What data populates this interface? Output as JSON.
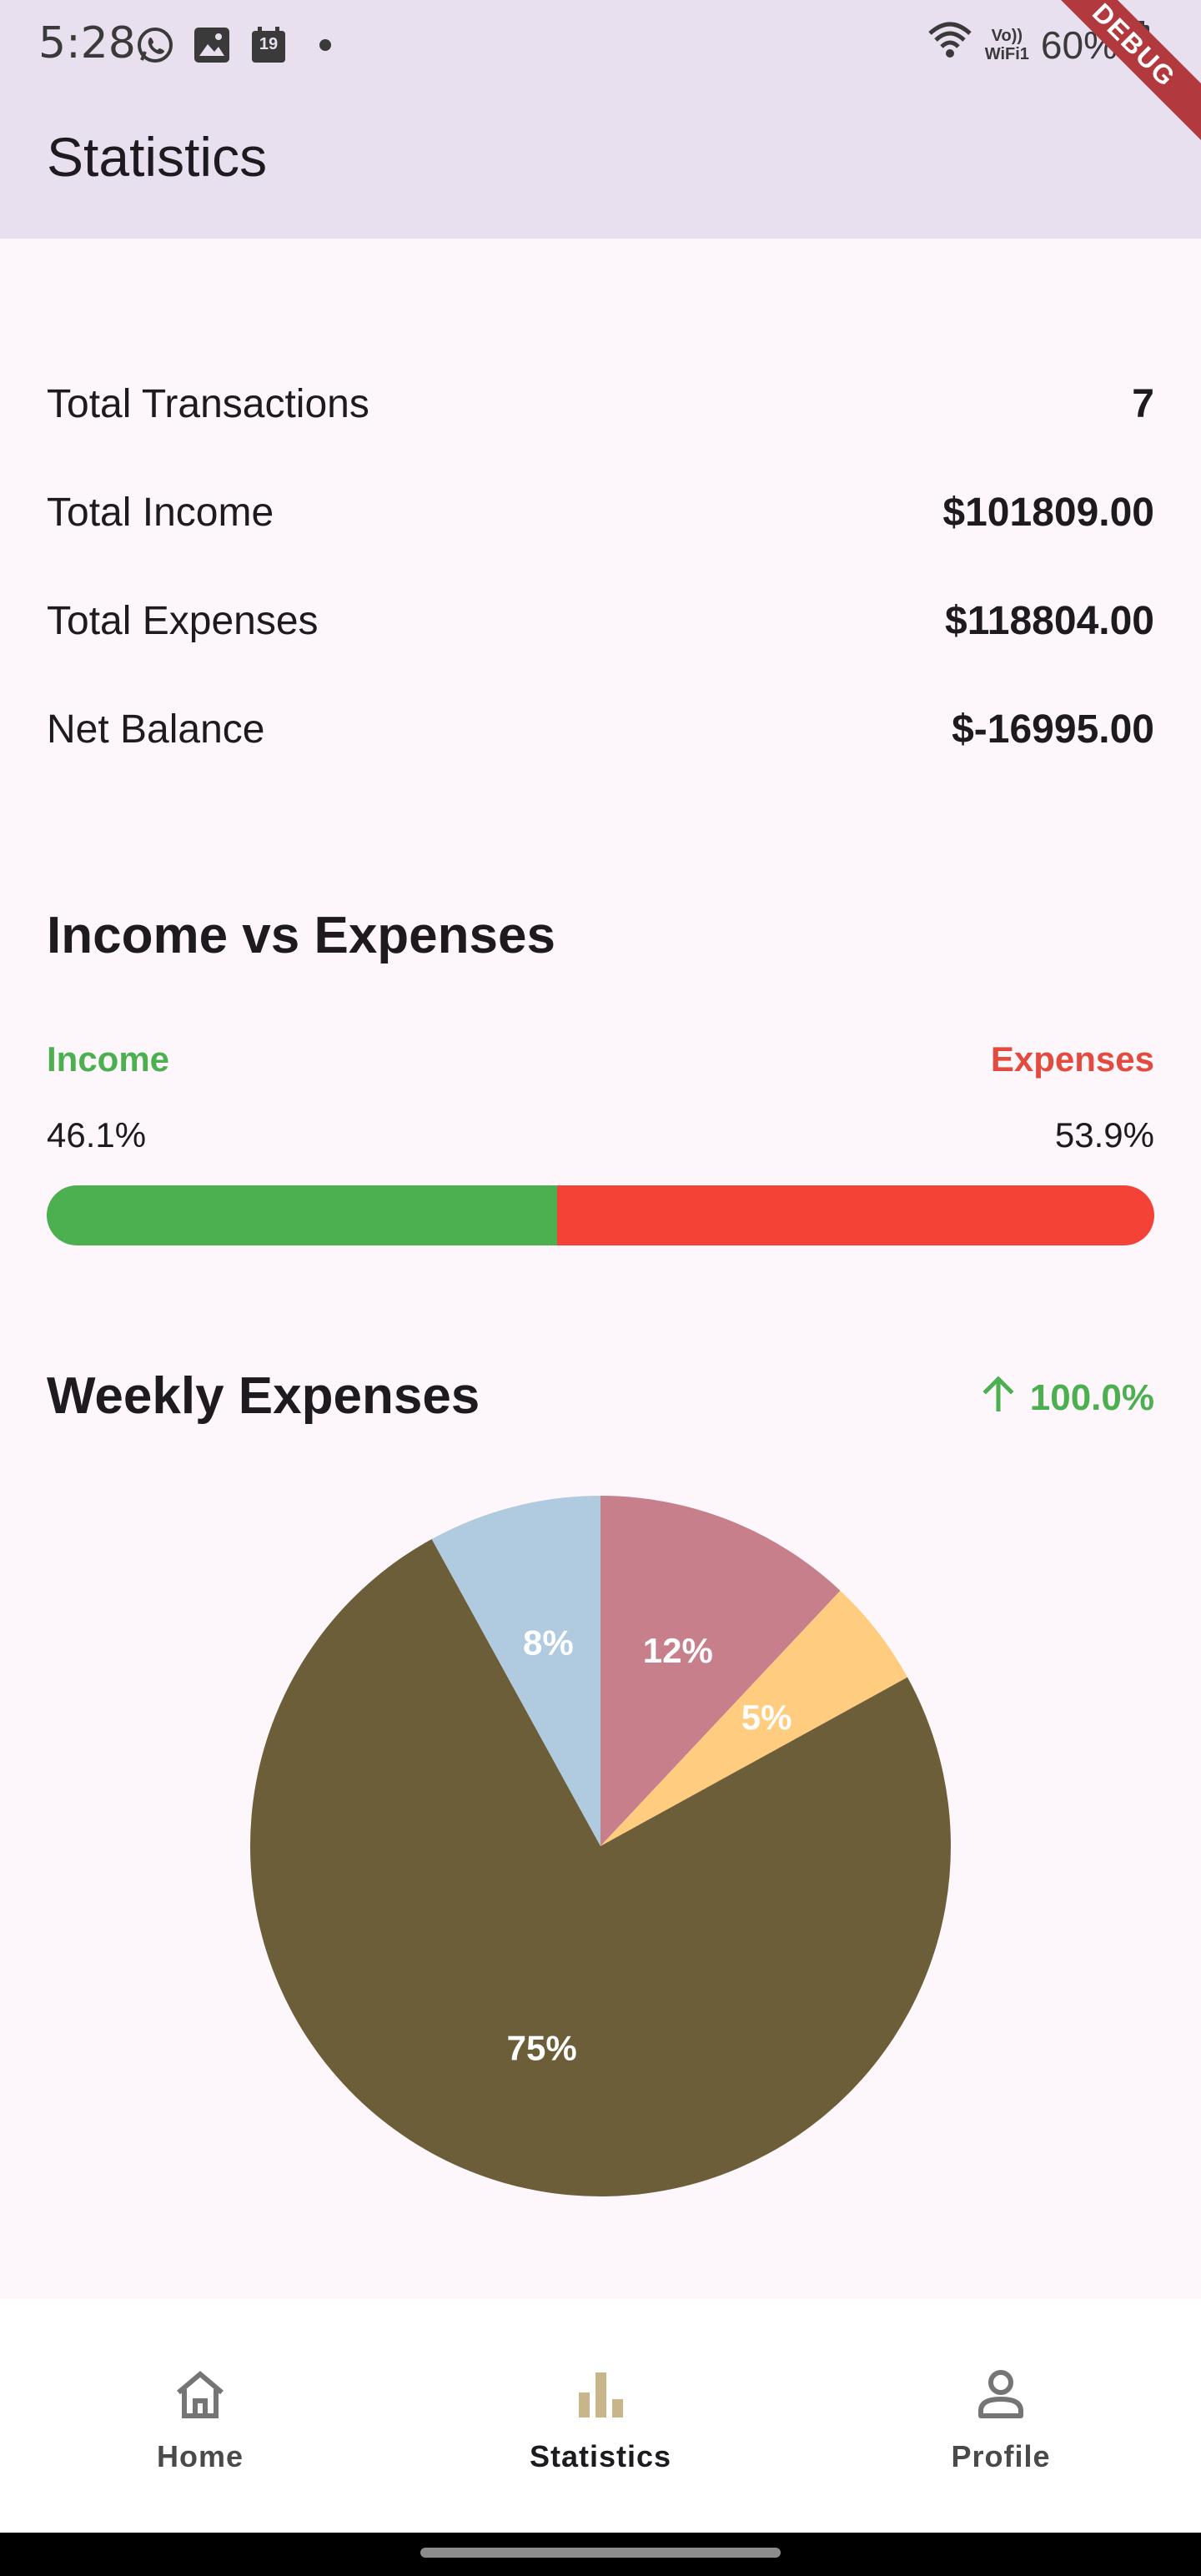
{
  "status_bar": {
    "time": "5:28",
    "left_icons": [
      "whatsapp-icon",
      "image-icon",
      "calendar-icon",
      "dot-icon"
    ],
    "calendar_day": "19",
    "volte_top": "Vo))",
    "volte_bottom": "WiFi1",
    "battery": "60%",
    "debug_banner": "DEBUG"
  },
  "app_bar": {
    "title": "Statistics"
  },
  "summary": {
    "rows": [
      {
        "label": "Total Transactions",
        "value": "7"
      },
      {
        "label": "Total Income",
        "value": "$101809.00"
      },
      {
        "label": "Total Expenses",
        "value": "$118804.00"
      },
      {
        "label": "Net Balance",
        "value": "$-16995.00"
      }
    ]
  },
  "income_vs_expenses": {
    "title": "Income vs Expenses",
    "income_label": "Income",
    "expenses_label": "Expenses",
    "income_pct": "46.1%",
    "expenses_pct": "53.9%",
    "income_fraction": 0.461,
    "colors": {
      "income": "#4caf50",
      "expenses": "#f44336"
    }
  },
  "weekly_expenses": {
    "title": "Weekly Expenses",
    "trend_icon": "arrow-up-icon",
    "trend_value": "100.0%"
  },
  "chart_data": {
    "type": "pie",
    "slices": [
      {
        "value": 12,
        "label": "12%",
        "color": "#c87f8c"
      },
      {
        "value": 5,
        "label": "5%",
        "color": "#ffcc80"
      },
      {
        "value": 75,
        "label": "75%",
        "color": "#6b5e38"
      },
      {
        "value": 8,
        "label": "8%",
        "color": "#b0cbe0"
      }
    ],
    "start_angle_deg": 0,
    "direction": "clockwise",
    "legend": "none"
  },
  "bottom_nav": {
    "items": [
      {
        "label": "Home",
        "icon": "home-icon",
        "active": false
      },
      {
        "label": "Statistics",
        "icon": "bar-chart-icon",
        "active": true
      },
      {
        "label": "Profile",
        "icon": "person-icon",
        "active": false
      }
    ]
  }
}
